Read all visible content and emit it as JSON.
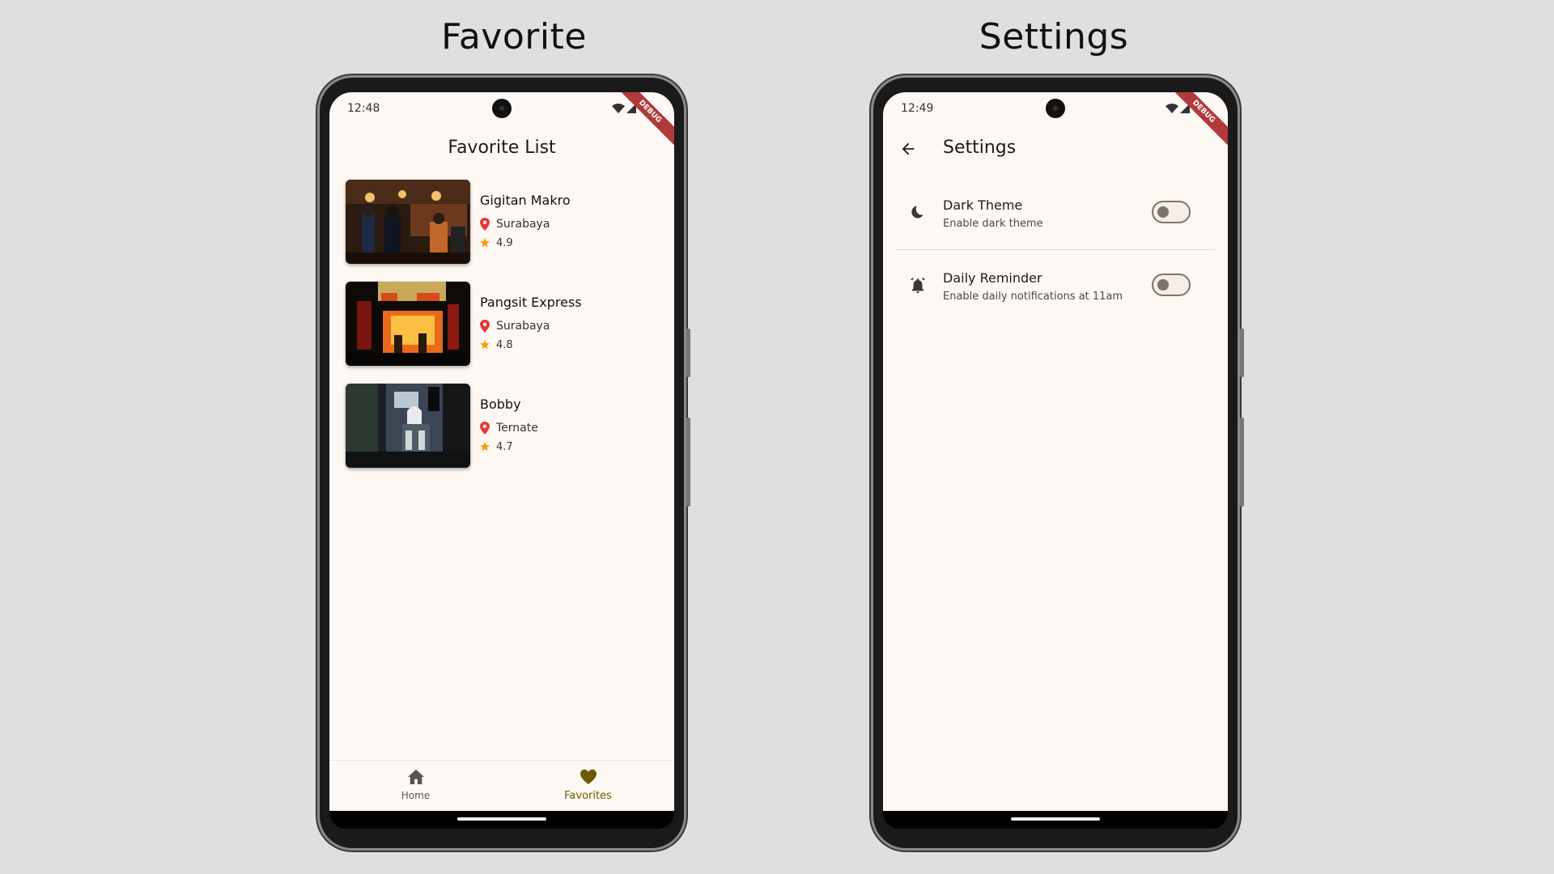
{
  "panels": {
    "left_title": "Favorite",
    "right_title": "Settings"
  },
  "favorite_screen": {
    "status_time": "12:48",
    "debug_label": "DEBUG",
    "app_title": "Favorite List",
    "items": [
      {
        "name": "Gigitan Makro",
        "city": "Surabaya",
        "rating": "4.9"
      },
      {
        "name": "Pangsit Express",
        "city": "Surabaya",
        "rating": "4.8"
      },
      {
        "name": "Bobby",
        "city": "Ternate",
        "rating": "4.7"
      }
    ],
    "nav": {
      "home_label": "Home",
      "favorites_label": "Favorites",
      "active": "Favorites"
    }
  },
  "settings_screen": {
    "status_time": "12:49",
    "debug_label": "DEBUG",
    "app_title": "Settings",
    "rows": [
      {
        "title": "Dark Theme",
        "subtitle": "Enable dark theme",
        "icon": "moon-icon",
        "enabled": false
      },
      {
        "title": "Daily Reminder",
        "subtitle": "Enable daily notifications at 11am",
        "icon": "alarm-bell-icon",
        "enabled": false
      }
    ]
  },
  "colors": {
    "screen_bg": "#fdf8f4",
    "active_nav": "#6f5a00",
    "inactive_nav": "#5a544e",
    "pin": "#e53935",
    "star": "#f59e0b",
    "debug_ribbon": "#b03a3a",
    "divider": "#e2d3c0"
  }
}
